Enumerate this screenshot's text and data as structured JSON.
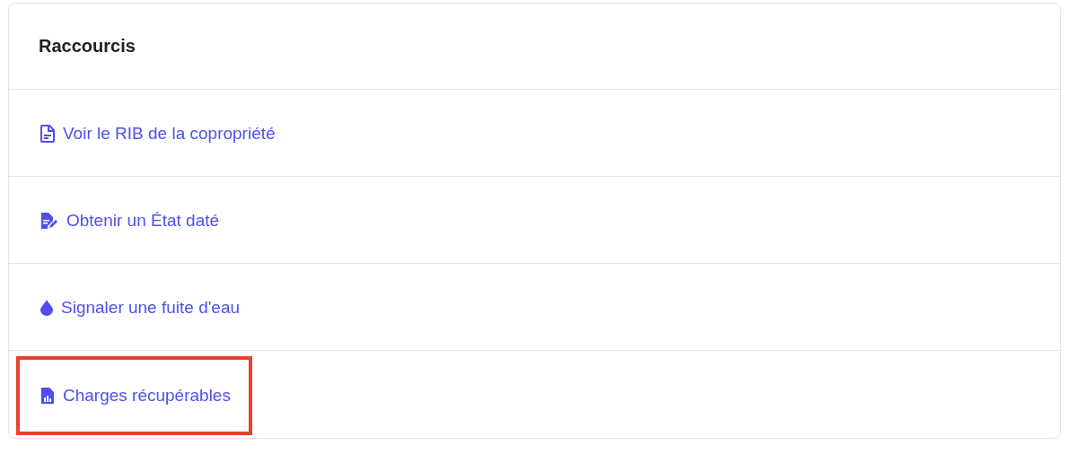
{
  "card": {
    "title": "Raccourcis"
  },
  "shortcuts": [
    {
      "kind": "document",
      "label": "Voir le RIB de la copropriété",
      "highlighted": false
    },
    {
      "kind": "edit",
      "label": "Obtenir un État daté",
      "highlighted": false
    },
    {
      "kind": "drop",
      "label": "Signaler une fuite d'eau",
      "highlighted": false
    },
    {
      "kind": "chart",
      "label": "Charges récupérables",
      "highlighted": true
    }
  ]
}
